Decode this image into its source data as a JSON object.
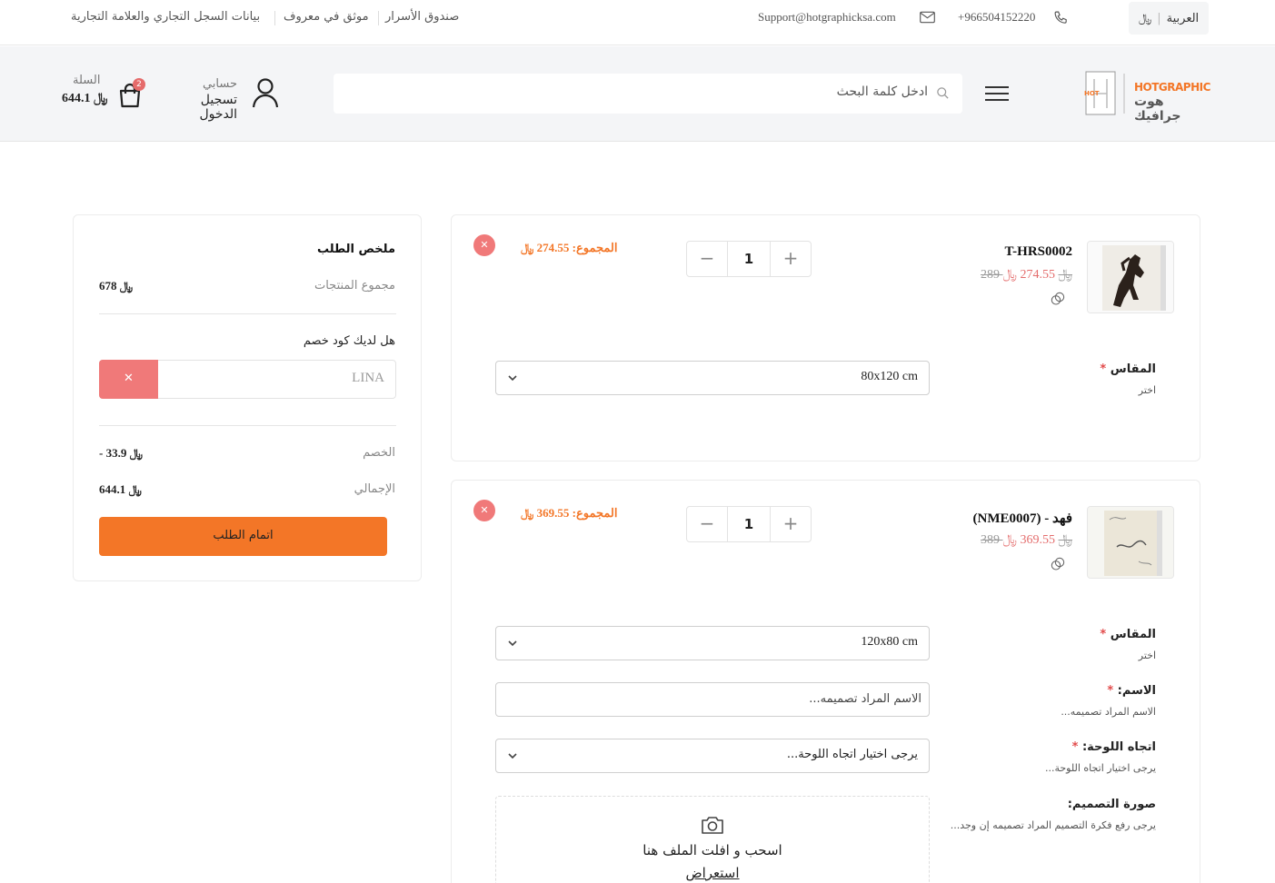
{
  "topbar": {
    "language": "العربية",
    "currency_symbol": "﷼",
    "phone": "+966504152220",
    "email": "Support@hotgraphicksa.com",
    "links": [
      "صندوق الأسرار",
      "موثق في معروف",
      "بيانات السجل التجاري والعلامة التجارية"
    ]
  },
  "header": {
    "logo_text_en": "HOTGRAPHIC",
    "logo_text_ar": "هوت جرافيك",
    "logo_mark": "HOT",
    "search_placeholder": "ادخل كلمة البحث",
    "account_label": "حسابي",
    "login_label": "تسجيل الدخول",
    "cart_label": "السلة",
    "cart_amount": "644.1 ﷼",
    "cart_count": "2"
  },
  "summary": {
    "title": "ملخص الطلب",
    "subtotal_label": "مجموع المنتجات",
    "subtotal_value": "678 ﷼",
    "coupon_question": "هل لديك كود خصم",
    "coupon_value": "LINA",
    "coupon_remove": "✕",
    "discount_label": "الخصم",
    "discount_value": "- 33.9 ﷼",
    "total_label": "الإجمالي",
    "total_value": "644.1 ﷼",
    "checkout_label": "اتمام الطلب"
  },
  "items": [
    {
      "name": "T-HRS0002",
      "price_new": "274.55 ﷼",
      "price_old": "289 ﷼",
      "qty": "1",
      "total": "المجموع: 274.55 ﷼",
      "remove": "✕",
      "size_label": "المقاس",
      "size_help": "اختر",
      "size_value": "80x120 cm"
    },
    {
      "name": "فهد - (NME0007)",
      "price_new": "369.55 ﷼",
      "price_old": "389 ﷼",
      "qty": "1",
      "total": "المجموع: 369.55 ﷼",
      "remove": "✕",
      "size_label": "المقاس",
      "size_help": "اختر",
      "size_value": "120x80 cm",
      "name_label": "الاسم:",
      "name_help": "الاسم المراد تصميمه...",
      "name_placeholder": "الاسم المراد تصميمه...",
      "orientation_label": "اتجاه اللوحة:",
      "orientation_help": "يرجى اختيار اتجاه اللوحة...",
      "orientation_value": "يرجى اختيار اتجاه اللوحة...",
      "image_label": "صورة التصميم:",
      "image_help": "يرجى رفع فكرة التصميم المراد تصميمه إن وجد...",
      "drop_text": "اسحب و افلت الملف هنا",
      "browse_text": "استعراض"
    }
  ],
  "required_mark": "*",
  "colors": {
    "accent": "#f37627",
    "danger": "#f07979",
    "price": "#e46d6d"
  }
}
